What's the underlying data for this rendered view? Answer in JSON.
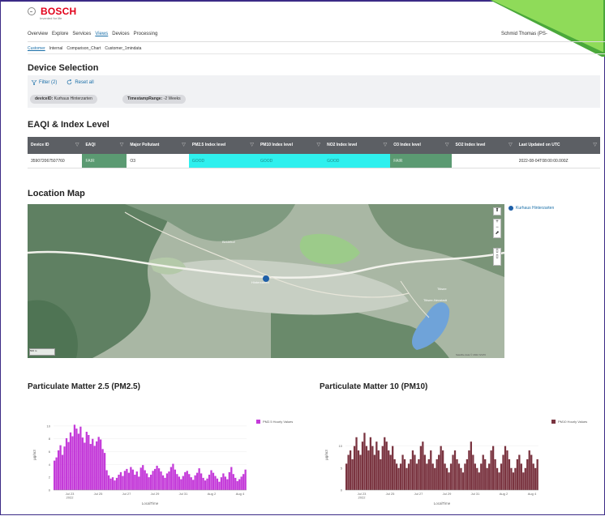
{
  "brand": {
    "name": "BOSCH",
    "tagline": "Invented for life"
  },
  "nav": [
    "Overview",
    "Explore",
    "Services",
    "Views",
    "Devices",
    "Processing"
  ],
  "nav_active": "Views",
  "user": "Schmid Thomas (PS-",
  "subnav": [
    "Customer",
    "Internal",
    "Comparison_Chart",
    "Customer_1mindata"
  ],
  "subnav_active": "Customer",
  "device_selection": {
    "title": "Device Selection",
    "filter_label": "Filter (2)",
    "reset_label": "Reset all",
    "chip1_key": "deviceID:",
    "chip1_val": "Kurhaus Hinterzarten",
    "chip2_key": "TimestampRange:",
    "chip2_val": "-2 Weeks"
  },
  "eaqi": {
    "title": "EAQI & Index Level",
    "columns": [
      "Device ID",
      "EAQI",
      "Major Pollutant",
      "PM2.5 Index level",
      "PM10 Index level",
      "NO2 Index level",
      "O3 Index level",
      "SO2 Index level",
      "Last Updated on UTC"
    ],
    "row": [
      "359072067507760",
      "FAIR",
      "O3",
      "GOOD",
      "GOOD",
      "GOOD",
      "FAIR",
      "",
      "2022-08-04T08:00:00.000Z"
    ]
  },
  "map": {
    "title": "Location Map",
    "legend": "Kurhaus Hinterzarten",
    "labels": [
      "Birklehof",
      "Hinterzarten",
      "Titisee-Neustadt",
      "Titisee"
    ],
    "attribution": "Satellite data © 2022 IVLP0",
    "scale": "500 m"
  },
  "charts": {
    "pm25_title": "Particulate Matter 2.5 (PM2.5)",
    "pm10_title": "Particulate Matter 10 (PM10)",
    "pm25_legend": "PM2.5 Hourly Values",
    "pm10_legend": "PM10 Hourly Values",
    "ylabel": "µg/m3",
    "xlabel": "LocalTime",
    "xticks": [
      "Jul 23\n2022",
      "Jul 25",
      "Jul 27",
      "Jul 29",
      "Jul 31",
      "Aug 2",
      "Aug 4"
    ],
    "pm25_yticks": [
      "0",
      "2",
      "4",
      "6",
      "8",
      "10"
    ],
    "pm10_yticks": [
      "0",
      "5",
      "10"
    ]
  },
  "chart_data": [
    {
      "type": "bar",
      "title": "Particulate Matter 2.5 (PM2.5)",
      "xlabel": "LocalTime",
      "ylabel": "µg/m3",
      "ylim": [
        0,
        11
      ],
      "series": [
        {
          "name": "PM2.5 Hourly Values",
          "color": "#c43bd9",
          "values": [
            4.6,
            5.1,
            6.2,
            7.0,
            5.5,
            6.8,
            8.1,
            7.5,
            9.0,
            8.4,
            10.2,
            9.6,
            8.8,
            9.9,
            8.2,
            7.4,
            9.1,
            8.6,
            7.2,
            8.0,
            6.9,
            7.6,
            8.3,
            7.9,
            6.4,
            5.8,
            3.1,
            2.3,
            1.8,
            2.0,
            1.5,
            1.9,
            2.4,
            2.8,
            2.2,
            3.0,
            3.3,
            2.7,
            3.6,
            3.2,
            2.4,
            2.9,
            2.1,
            3.5,
            3.9,
            3.1,
            2.6,
            2.0,
            2.4,
            3.0,
            3.3,
            3.8,
            3.4,
            2.9,
            2.3,
            1.9,
            2.6,
            2.9,
            3.6,
            4.1,
            3.2,
            2.5,
            2.1,
            1.7,
            2.2,
            2.8,
            3.0,
            2.5,
            2.0,
            1.6,
            2.3,
            2.7,
            3.4,
            2.6,
            1.9,
            1.5,
            1.8,
            2.4,
            3.1,
            2.7,
            2.2,
            1.8,
            1.3,
            2.0,
            2.6,
            2.1,
            1.7,
            2.8,
            3.6,
            2.5,
            1.9,
            1.4,
            1.7,
            2.1,
            2.5,
            3.2
          ]
        }
      ]
    },
    {
      "type": "bar",
      "title": "Particulate Matter 10 (PM10)",
      "xlabel": "LocalTime",
      "ylabel": "µg/m3",
      "ylim": [
        0,
        16
      ],
      "series": [
        {
          "name": "PM10 Hourly Values",
          "color": "#7a3440",
          "values": [
            6,
            8,
            9,
            7,
            10,
            12,
            9,
            8,
            11,
            13,
            10,
            9,
            12,
            10,
            8,
            11,
            9,
            7,
            10,
            12,
            11,
            9,
            8,
            10,
            7,
            6,
            5,
            6,
            8,
            7,
            5,
            6,
            7,
            9,
            8,
            6,
            7,
            10,
            11,
            8,
            6,
            7,
            9,
            6,
            5,
            7,
            8,
            10,
            9,
            6,
            5,
            4,
            6,
            8,
            9,
            7,
            6,
            5,
            4,
            6,
            7,
            9,
            11,
            8,
            6,
            5,
            4,
            6,
            8,
            7,
            5,
            6,
            9,
            10,
            7,
            5,
            4,
            6,
            8,
            10,
            9,
            7,
            5,
            4,
            5,
            7,
            8,
            6,
            4,
            5,
            7,
            9,
            8,
            6,
            5,
            7
          ]
        }
      ]
    }
  ]
}
